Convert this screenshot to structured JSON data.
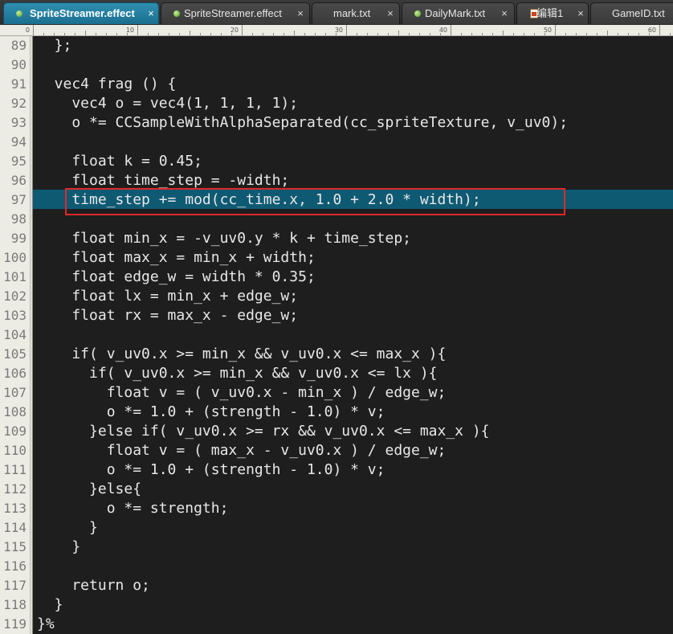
{
  "tabs": [
    {
      "label": "SpriteStreamer.effect",
      "icon": "green-dot-icon",
      "active": true,
      "close": "×"
    },
    {
      "label": "SpriteStreamer.effect",
      "icon": "green-dot-icon",
      "active": false,
      "close": "×"
    },
    {
      "label": "mark.txt",
      "icon": "",
      "active": false,
      "close": "×"
    },
    {
      "label": "DailyMark.txt",
      "icon": "green-dot-icon",
      "active": false,
      "close": "×"
    },
    {
      "label": "编辑1",
      "icon": "document-icon",
      "active": false,
      "close": "×"
    },
    {
      "label": "GameID.txt",
      "icon": "",
      "active": false,
      "close": ""
    }
  ],
  "ruler": {
    "labels": [
      "0",
      "10",
      "20",
      "30",
      "40",
      "50",
      "60"
    ]
  },
  "colors": {
    "active_tab": "#1b6f8f",
    "highlight_band": "#0f5a73",
    "highlight_box": "#e02828",
    "editor_bg": "#1e1e1e",
    "code_text": "#e8e8e8",
    "gutter_bg": "#ecece4"
  },
  "editor": {
    "highlighted_line": "97",
    "lines": [
      {
        "num": "89",
        "text": "  };"
      },
      {
        "num": "90",
        "text": ""
      },
      {
        "num": "91",
        "text": "  vec4 frag () {"
      },
      {
        "num": "92",
        "text": "    vec4 o = vec4(1, 1, 1, 1);"
      },
      {
        "num": "93",
        "text": "    o *= CCSampleWithAlphaSeparated(cc_spriteTexture, v_uv0);"
      },
      {
        "num": "94",
        "text": ""
      },
      {
        "num": "95",
        "text": "    float k = 0.45;"
      },
      {
        "num": "96",
        "text": "    float time_step = -width;"
      },
      {
        "num": "97",
        "text": "    time_step += mod(cc_time.x, 1.0 + 2.0 * width);"
      },
      {
        "num": "98",
        "text": ""
      },
      {
        "num": "99",
        "text": "    float min_x = -v_uv0.y * k + time_step;"
      },
      {
        "num": "100",
        "text": "    float max_x = min_x + width;"
      },
      {
        "num": "101",
        "text": "    float edge_w = width * 0.35;"
      },
      {
        "num": "102",
        "text": "    float lx = min_x + edge_w;"
      },
      {
        "num": "103",
        "text": "    float rx = max_x - edge_w;"
      },
      {
        "num": "104",
        "text": ""
      },
      {
        "num": "105",
        "text": "    if( v_uv0.x >= min_x && v_uv0.x <= max_x ){"
      },
      {
        "num": "106",
        "text": "      if( v_uv0.x >= min_x && v_uv0.x <= lx ){"
      },
      {
        "num": "107",
        "text": "        float v = ( v_uv0.x - min_x ) / edge_w;"
      },
      {
        "num": "108",
        "text": "        o *= 1.0 + (strength - 1.0) * v;"
      },
      {
        "num": "109",
        "text": "      }else if( v_uv0.x >= rx && v_uv0.x <= max_x ){"
      },
      {
        "num": "110",
        "text": "        float v = ( max_x - v_uv0.x ) / edge_w;"
      },
      {
        "num": "111",
        "text": "        o *= 1.0 + (strength - 1.0) * v;"
      },
      {
        "num": "112",
        "text": "      }else{"
      },
      {
        "num": "113",
        "text": "        o *= strength;"
      },
      {
        "num": "114",
        "text": "      }"
      },
      {
        "num": "115",
        "text": "    }"
      },
      {
        "num": "116",
        "text": ""
      },
      {
        "num": "117",
        "text": "    return o;"
      },
      {
        "num": "118",
        "text": "  }"
      },
      {
        "num": "119",
        "text": "}%"
      }
    ]
  }
}
